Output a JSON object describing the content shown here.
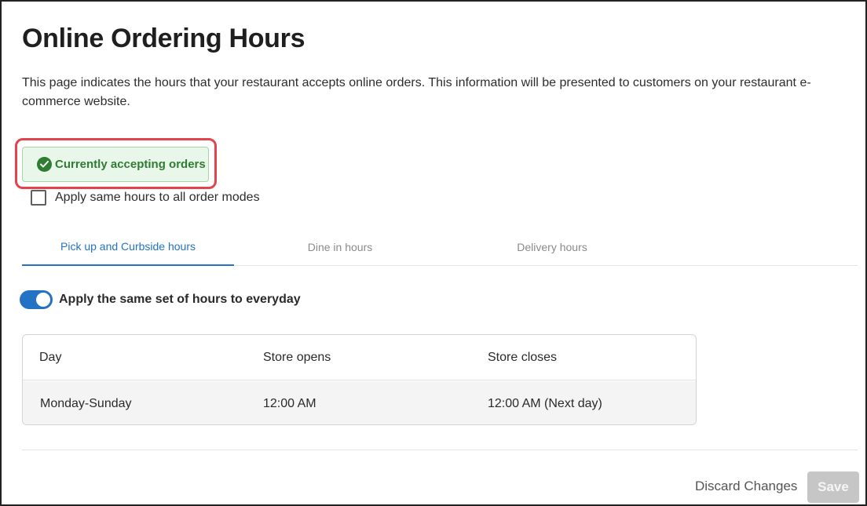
{
  "page": {
    "title": "Online Ordering Hours",
    "description": "This page indicates the hours that your restaurant accepts online orders. This information will be presented to customers on your restaurant e-commerce website."
  },
  "status": {
    "label": "Currently accepting orders",
    "icon": "check-circle-icon",
    "color": "#2e7d32"
  },
  "same_hours_all_modes": {
    "label": "Apply same hours to all order modes",
    "checked": false
  },
  "tabs": [
    {
      "label": "Pick up and Curbside hours",
      "active": true
    },
    {
      "label": "Dine in hours",
      "active": false
    },
    {
      "label": "Delivery hours",
      "active": false
    }
  ],
  "everyday_toggle": {
    "label": "Apply the same set of hours to everyday",
    "on": true
  },
  "hours_table": {
    "columns": [
      "Day",
      "Store opens",
      "Store closes"
    ],
    "rows": [
      [
        "Monday-Sunday",
        "12:00 AM",
        "12:00 AM (Next day)"
      ]
    ]
  },
  "footer": {
    "discard_label": "Discard Changes",
    "save_label": "Save"
  },
  "colors": {
    "accent": "#2372c6",
    "highlight": "#e3434d",
    "disabled": "#c6c6c6"
  }
}
